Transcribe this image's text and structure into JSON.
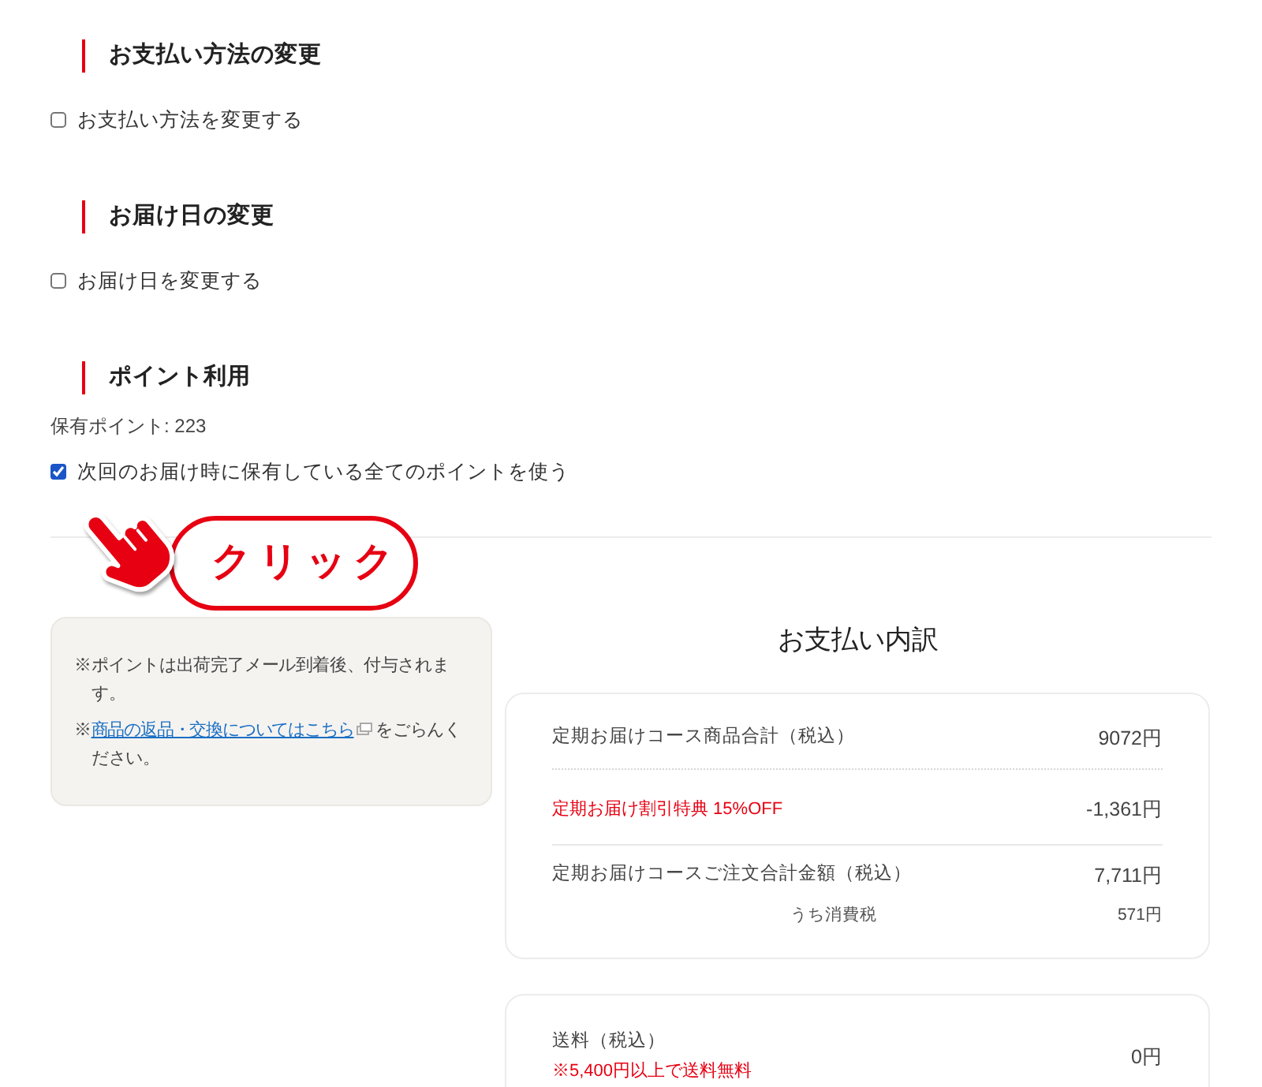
{
  "sections": [
    {
      "heading": "お支払い方法の変更",
      "options": [
        {
          "label": "お支払い方法を変更する",
          "checked": false
        }
      ]
    },
    {
      "heading": "お届け日の変更",
      "options": [
        {
          "label": "お届け日を変更する",
          "checked": false
        }
      ]
    },
    {
      "heading": "ポイント利用",
      "points_held": "保有ポイント: 223",
      "options": [
        {
          "label": "次回のお届け時に保有している全てのポイントを使う",
          "checked": true
        }
      ]
    }
  ],
  "annotation": {
    "text": "クリック"
  },
  "note": {
    "lines": [
      {
        "kind": "text",
        "text": "※ポイントは出荷完了メール到着後、付与されます。"
      },
      {
        "kind": "link",
        "prefix": "※",
        "link": "商品の返品・交換についてはこちら",
        "suffix": "をごらんください。"
      }
    ]
  },
  "breakdown": {
    "title": "お支払い内訳",
    "cards": [
      {
        "rows": [
          {
            "kind": "item",
            "label": "定期お届けコース商品合計（税込）",
            "value": "9072円"
          },
          {
            "kind": "discount",
            "label": "定期お届け割引特典 15%OFF",
            "value": "-1,361円"
          },
          {
            "kind": "total",
            "label": "定期お届けコースご注文合計金額（税込）",
            "value": "7,711円"
          },
          {
            "kind": "tax",
            "label": "うち消費税",
            "value": "571円"
          }
        ]
      },
      {
        "rows": [
          {
            "kind": "shipping",
            "label": "送料（税込）",
            "note": "※5,400円以上で送料無料",
            "value": "0円"
          }
        ]
      }
    ]
  }
}
